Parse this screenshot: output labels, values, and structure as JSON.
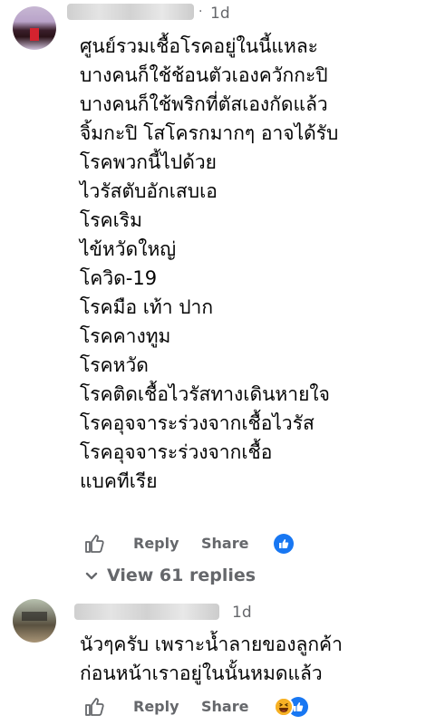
{
  "comment1": {
    "time": "1d",
    "lines": [
      "ศูนย์รวมเชื้อโรคอยู่ในนี้แหละ",
      "บางคนก็ใช้ช้อนตัวเองควักกะปิ",
      "บางคนก็ใช้พริกที่ตัสเองกัดแล้ว",
      "จิ้มกะปิ โสโครกมากๆ อาจได้รับ",
      "โรคพวกนี้ไปด้วย",
      "ไวรัสตับอักเสบเอ",
      "โรคเริม",
      "ไข้หวัดใหญ่",
      "โควิด-19",
      "โรคมือ เท้า ปาก",
      "โรคคางทูม",
      "โรคหวัด",
      "โรคติดเชื้อไวรัสทางเดินหายใจ",
      "โรคอุจจาระร่วงจากเชื้อไวรัส",
      "โรคอุจจาระร่วงจากเชื้อ",
      "แบคทีเรีย"
    ],
    "reply_label": "Reply",
    "share_label": "Share"
  },
  "replies": {
    "view_label": "View 61 replies"
  },
  "comment2": {
    "time": "1d",
    "lines": [
      "นัวๆครับ เพราะน้ำลายของลูกค้า",
      "ก่อนหน้าเราอยู่ในนั้นหมดแล้ว"
    ],
    "reply_label": "Reply",
    "share_label": "Share"
  },
  "colors": {
    "accent": "#1877f2",
    "secondary_text": "#65676b",
    "primary_text": "#050505"
  },
  "icons": [
    "like-thumb-icon",
    "like-reaction-icon",
    "haha-reaction-icon",
    "chevron-down-icon"
  ]
}
